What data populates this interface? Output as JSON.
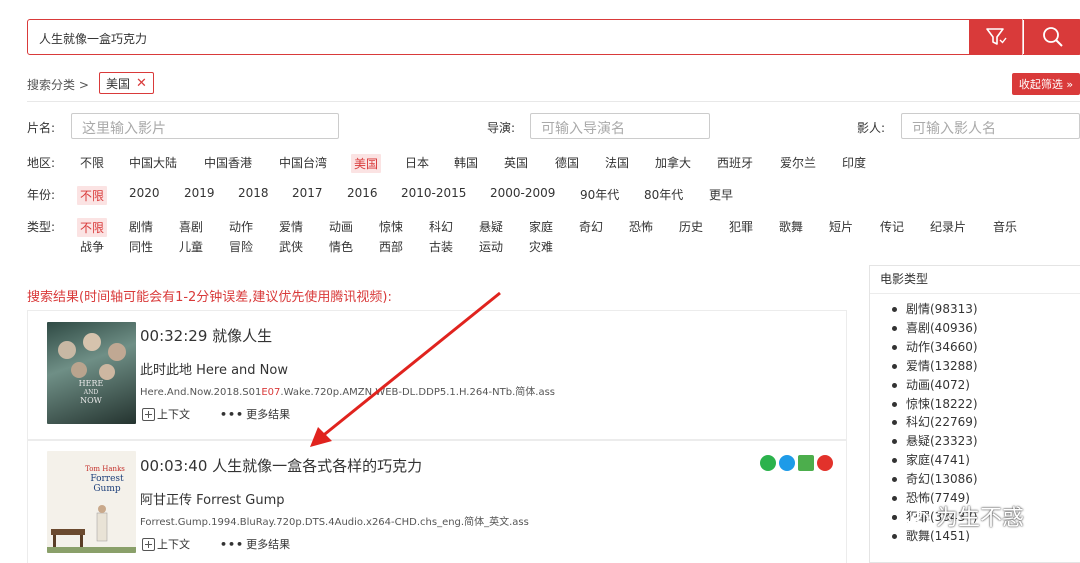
{
  "search": {
    "query": "人生就像一盒巧克力"
  },
  "category": {
    "crumb": "搜索分类 >",
    "tag": "美国",
    "tag_close": "✕",
    "collapse": "收起筛选 »"
  },
  "filters": {
    "title": {
      "label": "片名:",
      "placeholder": "这里输入影片"
    },
    "director": {
      "label": "导演:",
      "placeholder": "可输入导演名"
    },
    "actor": {
      "label": "影人:",
      "placeholder": "可输入影人名"
    }
  },
  "region": {
    "label": "地区:",
    "options": [
      "不限",
      "中国大陆",
      "中国香港",
      "中国台湾",
      "美国",
      "日本",
      "韩国",
      "英国",
      "德国",
      "法国",
      "加拿大",
      "西班牙",
      "爱尔兰",
      "印度"
    ],
    "selected": "美国"
  },
  "year": {
    "label": "年份:",
    "options": [
      "不限",
      "2020",
      "2019",
      "2018",
      "2017",
      "2016",
      "2010-2015",
      "2000-2009",
      "90年代",
      "80年代",
      "更早"
    ],
    "selected": "不限"
  },
  "genre": {
    "label": "类型:",
    "row1": [
      "不限",
      "剧情",
      "喜剧",
      "动作",
      "爱情",
      "动画",
      "惊悚",
      "科幻",
      "悬疑",
      "家庭",
      "奇幻",
      "恐怖",
      "历史",
      "犯罪",
      "歌舞",
      "短片",
      "传记",
      "纪录片",
      "音乐"
    ],
    "row2": [
      "战争",
      "同性",
      "儿童",
      "冒险",
      "武侠",
      "情色",
      "西部",
      "古装",
      "运动",
      "灾难"
    ],
    "selected": "不限"
  },
  "results": {
    "header": "搜索结果(时间轴可能会有1-2分钟误差,建议优先使用腾讯视频):",
    "items": [
      {
        "time_line": "00:32:29 就像人生",
        "title": "此时此地 Here and Now",
        "file_a": "Here.And.Now.2018.S01",
        "file_hl": "E07",
        "file_b": ".Wake.720p.AMZN.WEB-DL.DDP5.1.H.264-NTb.简体.ass",
        "context": "上下文",
        "more": "更多结果",
        "poster_text": "HERE AND NOW"
      },
      {
        "time_line": "00:03:40 人生就像一盒各式各样的巧克力",
        "title": "阿甘正传 Forrest Gump",
        "file_a": "Forrest.Gump.1994.BluRay.720p.DTS.4Audio.x264-CHD.chs_eng.简体_英文.ass",
        "file_hl": "",
        "file_b": "",
        "context": "上下文",
        "more": "更多结果",
        "poster_text": "Tom Hanks Forrest Gump"
      }
    ]
  },
  "sidebar": {
    "title": "电影类型",
    "items": [
      "剧情(98313)",
      "喜剧(40936)",
      "动作(34660)",
      "爱情(13288)",
      "动画(4072)",
      "惊悚(18222)",
      "科幻(22769)",
      "悬疑(23323)",
      "家庭(4741)",
      "奇幻(13086)",
      "恐怖(7749)",
      "",
      "犯罪(38437)",
      "歌舞(1451)"
    ]
  },
  "watermark": "为生不惑",
  "colors": {
    "accent": "#d93a3a"
  }
}
